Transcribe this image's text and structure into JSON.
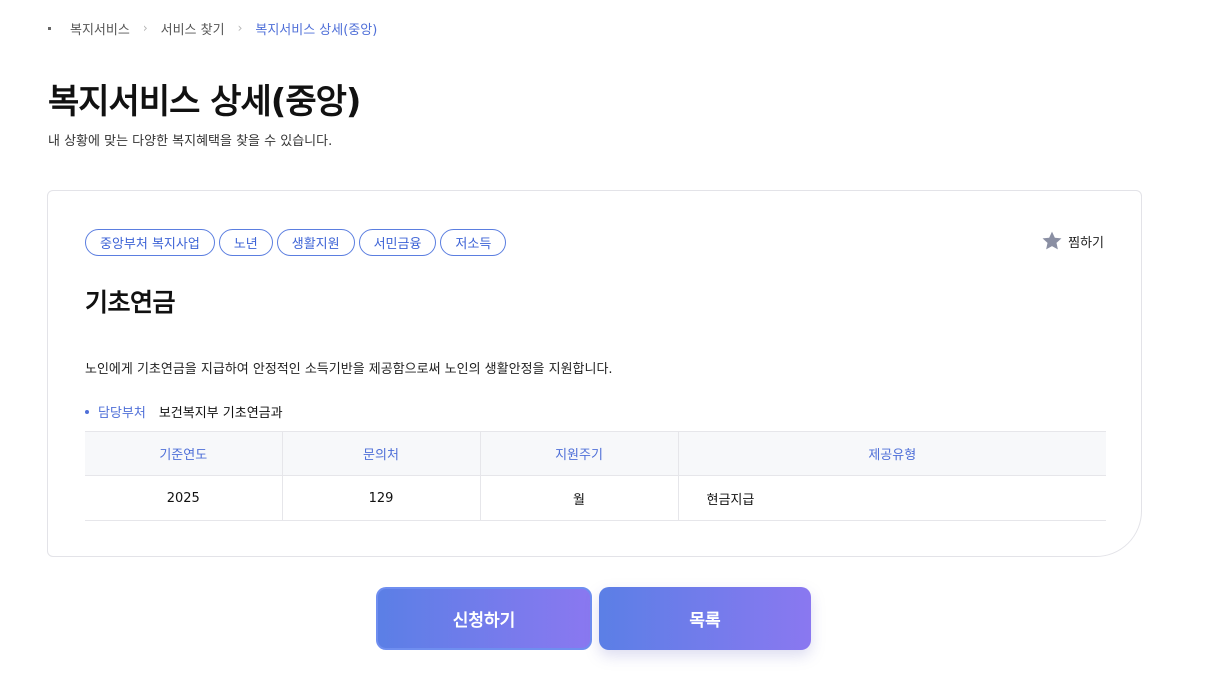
{
  "breadcrumb": {
    "items": [
      "복지서비스",
      "서비스 찾기",
      "복지서비스 상세(중앙)"
    ]
  },
  "page": {
    "title": "복지서비스 상세(중앙)",
    "subtitle": "내 상황에 맞는 다양한 복지혜택을 찾을 수 있습니다."
  },
  "service": {
    "tags": [
      "중앙부처 복지사업",
      "노년",
      "생활지원",
      "서민금융",
      "저소득"
    ],
    "favorite_label": "찜하기",
    "name": "기초연금",
    "description": "노인에게 기초연금을 지급하여 안정적인 소득기반을 제공함으로써 노인의 생활안정을 지원합니다.",
    "dept_label": "담당부처",
    "dept_value": "보건복지부 기초연금과",
    "table": {
      "headers": [
        "기준연도",
        "문의처",
        "지원주기",
        "제공유형"
      ],
      "row": [
        "2025",
        "129",
        "월",
        "현금지급"
      ]
    }
  },
  "actions": {
    "apply_label": "신청하기",
    "list_label": "목록"
  },
  "colors": {
    "accent": "#4f6fd8",
    "button_gradient_start": "#5b7fe6",
    "button_gradient_end": "#8a78f0",
    "star": "#8a8fa3"
  },
  "icons": {
    "favorite": "star-icon",
    "breadcrumb_separator": "chevron-right-icon"
  }
}
